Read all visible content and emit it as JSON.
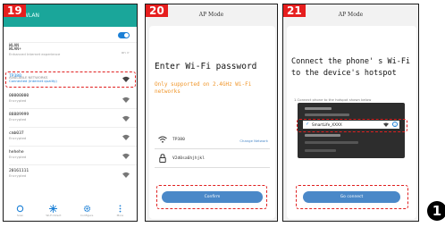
{
  "panel1": {
    "step": "19",
    "header_title": "WLAN",
    "wlan_label": "WLAN",
    "wlan_plus": "WLAN+",
    "wlan_plus_sub": "Enhanced Internet experience",
    "wlan_plus_value": "on >",
    "available_networks": "AVAILABLE NETWORKS",
    "networks": [
      {
        "name": "TP380",
        "sub": "Connected (Internet quality)",
        "highlight": true
      },
      {
        "name": "00000000",
        "sub": "Encrypted"
      },
      {
        "name": "88889999",
        "sub": "Encrypted"
      },
      {
        "name": "cmb037",
        "sub": "Encrypted"
      },
      {
        "name": "hehehe",
        "sub": "Encrypted"
      },
      {
        "name": "20161111",
        "sub": "Encrypted"
      }
    ],
    "nav": [
      {
        "label": "Scan",
        "icon": "refresh-icon"
      },
      {
        "label": "Wi-Fi Direct",
        "icon": "wifi-direct-icon"
      },
      {
        "label": "Configure",
        "icon": "gear-icon"
      },
      {
        "label": "More",
        "icon": "more-icon"
      }
    ]
  },
  "panel2": {
    "step": "20",
    "ap_title": "AP Mode",
    "heading": "Enter Wi-Fi password",
    "note": "Only supported on 2.4GHz Wi-Fi networks",
    "ssid": "TP380",
    "change_network": "Change Network",
    "password": "V2d0sa6hjhjkl",
    "confirm": "Confirm"
  },
  "panel3": {
    "step": "21",
    "ap_title": "AP Mode",
    "heading": "Connect the phone' s Wi-Fi to the device's hotspot",
    "instruction": "1.Connect phone to the hotspot shown below",
    "hotspot_ssid": "SmartLife_XXXX",
    "go_connect": "Go connect"
  },
  "corner_number": "1",
  "colors": {
    "teal_header": "#1aa69a",
    "step_red": "#e61e1e",
    "dash_red": "#e02020",
    "button_blue": "#4a88c8",
    "note_orange": "#f0962b"
  }
}
